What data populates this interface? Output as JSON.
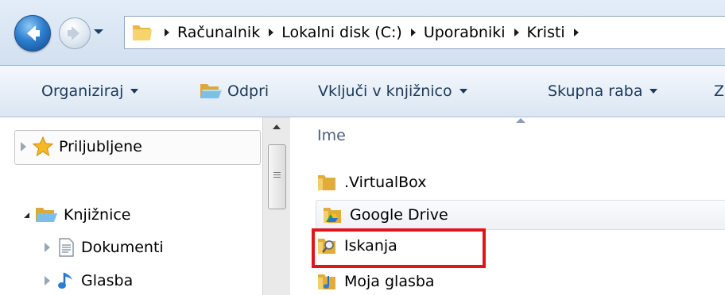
{
  "address_bar": {
    "breadcrumbs": [
      "Računalnik",
      "Lokalni disk (C:)",
      "Uporabniki",
      "Kristi"
    ]
  },
  "command_bar": {
    "organize": "Organiziraj",
    "open": "Odpri",
    "include_in_library": "Vključi v knjižnico",
    "share_with": "Skupna raba",
    "cut_off_next": "Z"
  },
  "navigation_pane": {
    "favorites": "Priljubljene",
    "libraries": "Knjižnice",
    "library_items": [
      "Dokumenti",
      "Glasba"
    ]
  },
  "content": {
    "column_name": "Ime",
    "files": [
      ".VirtualBox",
      "Google Drive",
      "Iskanja",
      "Moja glasba"
    ]
  },
  "colors": {
    "highlight": "#e0161b",
    "command_text": "#1e395b"
  }
}
